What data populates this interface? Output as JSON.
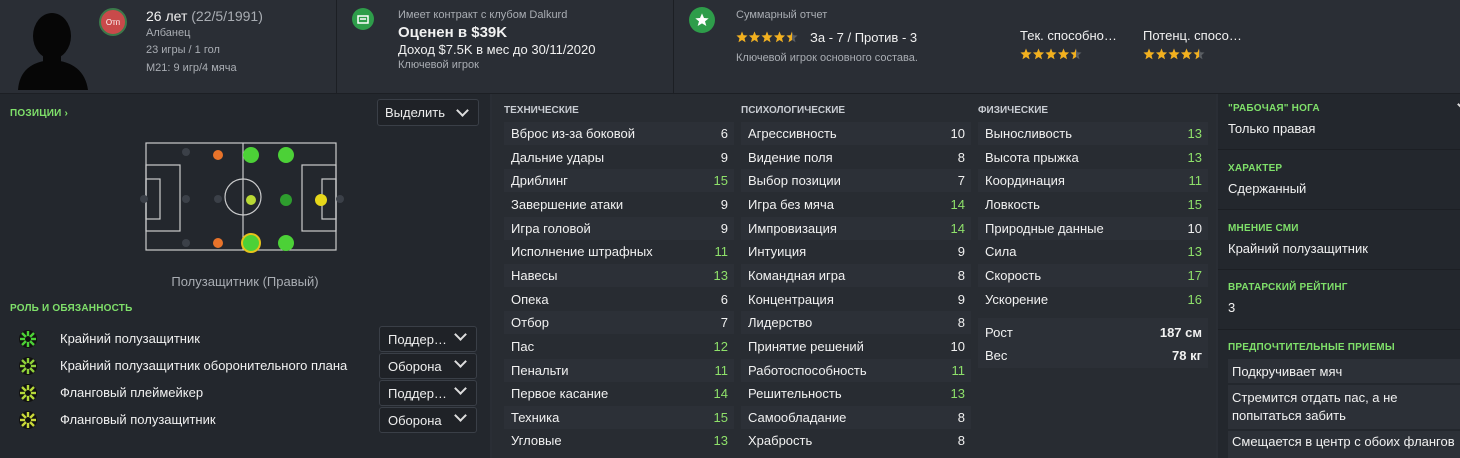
{
  "header": {
    "age_label": "26 лет",
    "dob": "(22/5/1991)",
    "nation": "Албанец",
    "nation_badge": "Отп",
    "apps": "23 игры / 1 гол",
    "u21": "M21: 9 игр/4 мяча",
    "contract_label": "Имеет контракт с клубом Dalkurd",
    "value": "Оценен в $39K",
    "wage": "Доход $7.5K в мес до 30/11/2020",
    "status": "Ключевой игрок",
    "report_label": "Суммарный отчет",
    "report_stars": 4.5,
    "report_votes": "За - 7 / Против - 3",
    "report_text": "Ключевой игрок основного состава.",
    "current_ability_label": "Тек. способно…",
    "current_ability_stars": 4.5,
    "potential_ability_label": "Потенц. спосо…",
    "potential_ability_stars": 4.5
  },
  "positions": {
    "title": "ПОЗИЦИИ",
    "select_label": "Выделить",
    "pitch_caption": "Полузащитник (Правый)"
  },
  "roles": {
    "title": "РОЛЬ И ОБЯЗАННОСТЬ",
    "items": [
      {
        "name": "Крайний полузащитник",
        "duty": "Поддер…"
      },
      {
        "name": "Крайний полузащитник оборонительного плана",
        "duty": "Оборона"
      },
      {
        "name": "Фланговый плеймейкер",
        "duty": "Поддер…"
      },
      {
        "name": "Фланговый полузащитник",
        "duty": "Оборона"
      }
    ]
  },
  "technical": {
    "title": "ТЕХНИЧЕСКИЕ",
    "items": [
      {
        "name": "Вброс из-за боковой",
        "value": "6"
      },
      {
        "name": "Дальние удары",
        "value": "9"
      },
      {
        "name": "Дриблинг",
        "value": "15"
      },
      {
        "name": "Завершение атаки",
        "value": "9"
      },
      {
        "name": "Игра головой",
        "value": "9"
      },
      {
        "name": "Исполнение штрафных",
        "value": "11"
      },
      {
        "name": "Навесы",
        "value": "13"
      },
      {
        "name": "Опека",
        "value": "6"
      },
      {
        "name": "Отбор",
        "value": "7"
      },
      {
        "name": "Пас",
        "value": "12"
      },
      {
        "name": "Пенальти",
        "value": "11"
      },
      {
        "name": "Первое касание",
        "value": "14"
      },
      {
        "name": "Техника",
        "value": "15"
      },
      {
        "name": "Угловые",
        "value": "13"
      }
    ]
  },
  "mental": {
    "title": "ПСИХОЛОГИЧЕСКИЕ",
    "items": [
      {
        "name": "Агрессивность",
        "value": "10"
      },
      {
        "name": "Видение поля",
        "value": "8"
      },
      {
        "name": "Выбор позиции",
        "value": "7"
      },
      {
        "name": "Игра без мяча",
        "value": "14"
      },
      {
        "name": "Импровизация",
        "value": "14"
      },
      {
        "name": "Интуиция",
        "value": "9"
      },
      {
        "name": "Командная игра",
        "value": "8"
      },
      {
        "name": "Концентрация",
        "value": "9"
      },
      {
        "name": "Лидерство",
        "value": "8"
      },
      {
        "name": "Принятие решений",
        "value": "10"
      },
      {
        "name": "Работоспособность",
        "value": "11"
      },
      {
        "name": "Решительность",
        "value": "13"
      },
      {
        "name": "Самообладание",
        "value": "8"
      },
      {
        "name": "Храбрость",
        "value": "8"
      }
    ]
  },
  "physical": {
    "title": "ФИЗИЧЕСКИЕ",
    "items": [
      {
        "name": "Выносливость",
        "value": "13"
      },
      {
        "name": "Высота прыжка",
        "value": "13"
      },
      {
        "name": "Координация",
        "value": "11"
      },
      {
        "name": "Ловкость",
        "value": "15"
      },
      {
        "name": "Природные данные",
        "value": "10"
      },
      {
        "name": "Сила",
        "value": "13"
      },
      {
        "name": "Скорость",
        "value": "17"
      },
      {
        "name": "Ускорение",
        "value": "16"
      }
    ],
    "height_label": "Рост",
    "height_value": "187 см",
    "weight_label": "Вес",
    "weight_value": "78 кг"
  },
  "side": {
    "foot_label": "\"РАБОЧАЯ\" НОГА",
    "foot_value": "Только правая",
    "character_label": "ХАРАКТЕР",
    "character_value": "Сдержанный",
    "media_label": "МНЕНИЕ СМИ",
    "media_value": "Крайний полузащитник",
    "gk_label": "ВРАТАРСКИЙ РЕЙТИНГ",
    "gk_value": "3",
    "ppm_label": "ПРЕДПОЧТИТЕЛЬНЫЕ ПРИЕМЫ",
    "ppm_items": [
      "Подкручивает мяч",
      "Стремится отдать пас, а не попытаться забить",
      "Смещается в центр с обоих флангов"
    ]
  },
  "colors": {
    "accent": "#7fe06a",
    "good": "#8ee06a",
    "position_natural": "#4cd137",
    "position_accomplished": "#2e9d2e",
    "position_yellow": "#e6d71a",
    "position_orange": "#e8732a"
  }
}
